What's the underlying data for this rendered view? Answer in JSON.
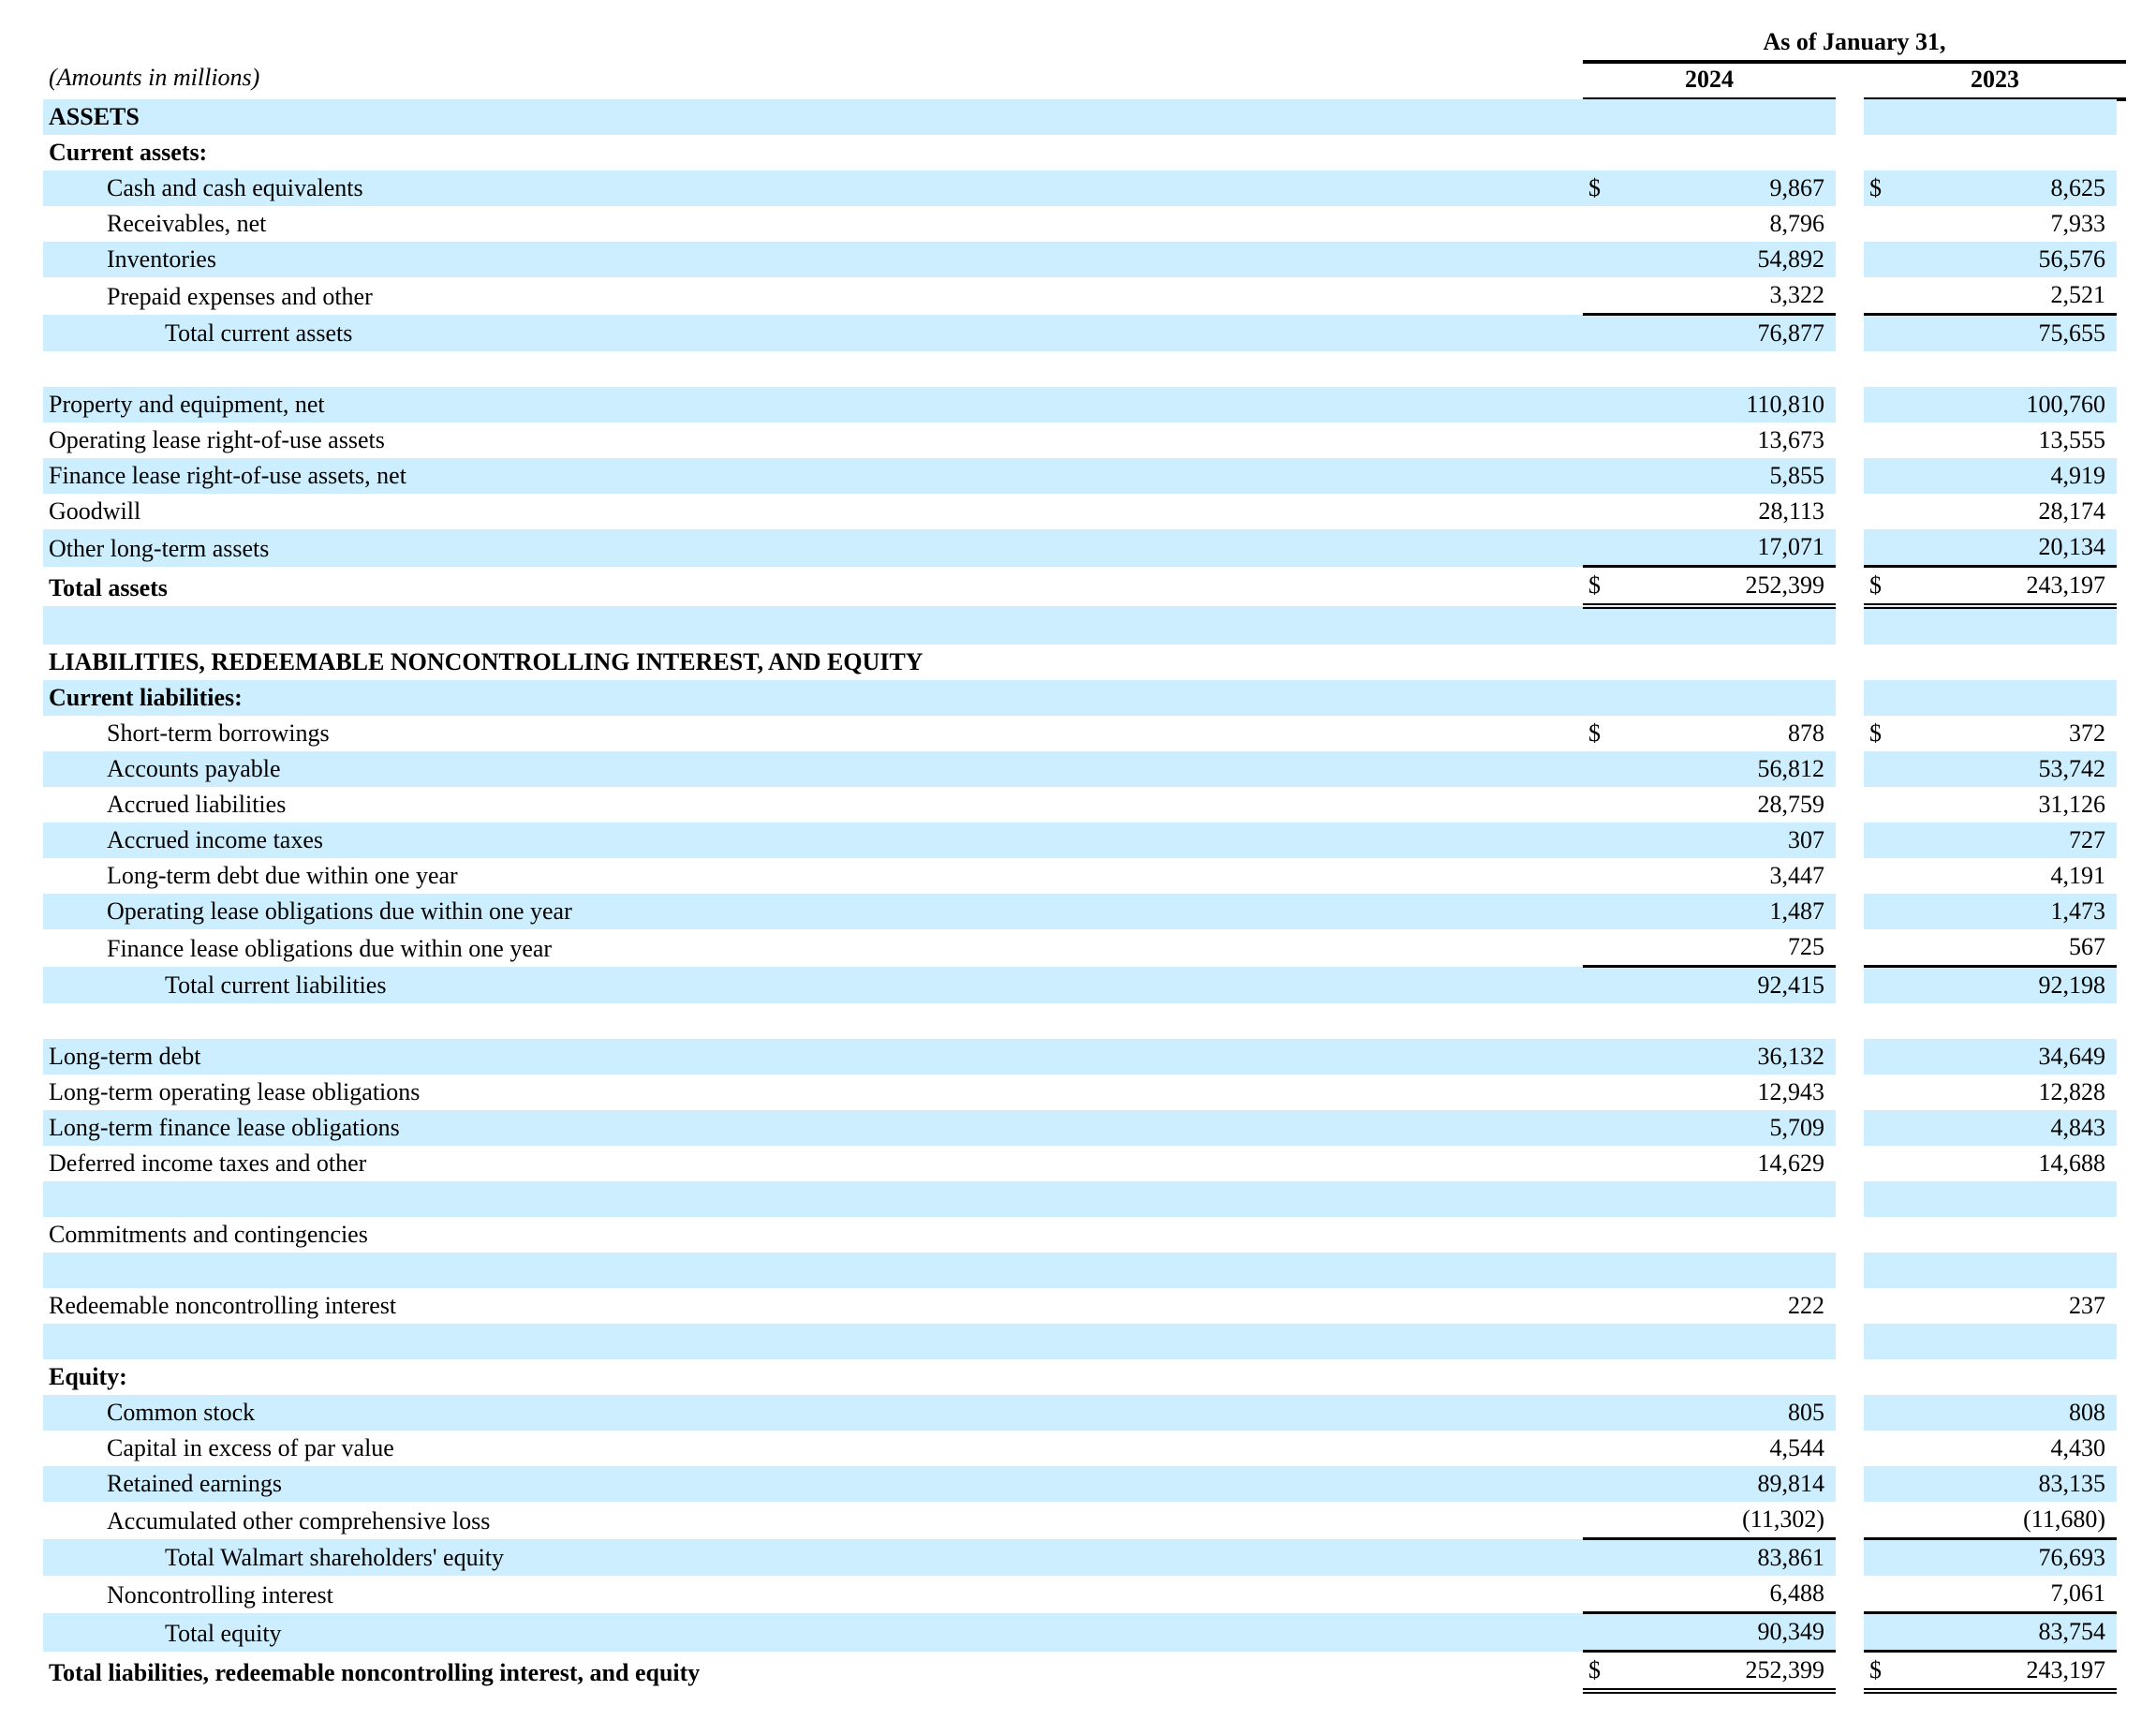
{
  "header": {
    "as_of": "As of January 31,",
    "units": "(Amounts in millions)",
    "col_2024": "2024",
    "col_2023": "2023"
  },
  "rows": [
    {
      "label": "ASSETS",
      "indent": 0,
      "bold": true,
      "shade": true
    },
    {
      "label": "Current assets:",
      "indent": 0,
      "bold": true,
      "shade": false
    },
    {
      "label": "Cash and cash equivalents",
      "indent": 1,
      "shade": true,
      "cur": true,
      "v2024": "9,867",
      "v2023": "8,625"
    },
    {
      "label": "Receivables, net",
      "indent": 1,
      "shade": false,
      "v2024": "8,796",
      "v2023": "7,933"
    },
    {
      "label": "Inventories",
      "indent": 1,
      "shade": true,
      "v2024": "54,892",
      "v2023": "56,576"
    },
    {
      "label": "Prepaid expenses and other",
      "indent": 1,
      "shade": false,
      "v2024": "3,322",
      "v2023": "2,521"
    },
    {
      "label": "Total current assets",
      "indent": 2,
      "shade": true,
      "top_rule": true,
      "v2024": "76,877",
      "v2023": "75,655"
    },
    {
      "label": "",
      "shade": false,
      "spacer": true
    },
    {
      "label": "Property and equipment, net",
      "indent": 0,
      "shade": true,
      "v2024": "110,810",
      "v2023": "100,760"
    },
    {
      "label": "Operating lease right-of-use assets",
      "indent": 0,
      "shade": false,
      "v2024": "13,673",
      "v2023": "13,555"
    },
    {
      "label": "Finance lease right-of-use assets, net",
      "indent": 0,
      "shade": true,
      "v2024": "5,855",
      "v2023": "4,919"
    },
    {
      "label": "Goodwill",
      "indent": 0,
      "shade": false,
      "v2024": "28,113",
      "v2023": "28,174"
    },
    {
      "label": "Other long-term assets",
      "indent": 0,
      "shade": true,
      "v2024": "17,071",
      "v2023": "20,134"
    },
    {
      "label": "Total assets",
      "indent": 0,
      "bold": true,
      "shade": false,
      "cur": true,
      "top_rule": true,
      "double": true,
      "v2024": "252,399",
      "v2023": "243,197"
    },
    {
      "label": "",
      "shade": true,
      "spacer": true
    },
    {
      "label": "LIABILITIES, REDEEMABLE NONCONTROLLING INTEREST, AND EQUITY",
      "indent": 0,
      "bold": true,
      "shade": false
    },
    {
      "label": "Current liabilities:",
      "indent": 0,
      "bold": true,
      "shade": true
    },
    {
      "label": "Short-term borrowings",
      "indent": 1,
      "shade": false,
      "cur": true,
      "v2024": "878",
      "v2023": "372"
    },
    {
      "label": "Accounts payable",
      "indent": 1,
      "shade": true,
      "v2024": "56,812",
      "v2023": "53,742"
    },
    {
      "label": "Accrued liabilities",
      "indent": 1,
      "shade": false,
      "v2024": "28,759",
      "v2023": "31,126"
    },
    {
      "label": "Accrued income taxes",
      "indent": 1,
      "shade": true,
      "v2024": "307",
      "v2023": "727"
    },
    {
      "label": "Long-term debt due within one year",
      "indent": 1,
      "shade": false,
      "v2024": "3,447",
      "v2023": "4,191"
    },
    {
      "label": "Operating lease obligations due within one year",
      "indent": 1,
      "shade": true,
      "v2024": "1,487",
      "v2023": "1,473"
    },
    {
      "label": "Finance lease obligations due within one year",
      "indent": 1,
      "shade": false,
      "v2024": "725",
      "v2023": "567"
    },
    {
      "label": "Total current liabilities",
      "indent": 2,
      "shade": true,
      "top_rule": true,
      "v2024": "92,415",
      "v2023": "92,198"
    },
    {
      "label": "",
      "shade": false,
      "spacer": true
    },
    {
      "label": "Long-term debt",
      "indent": 0,
      "shade": true,
      "v2024": "36,132",
      "v2023": "34,649"
    },
    {
      "label": "Long-term operating lease obligations",
      "indent": 0,
      "shade": false,
      "v2024": "12,943",
      "v2023": "12,828"
    },
    {
      "label": "Long-term finance lease obligations",
      "indent": 0,
      "shade": true,
      "v2024": "5,709",
      "v2023": "4,843"
    },
    {
      "label": "Deferred income taxes and other",
      "indent": 0,
      "shade": false,
      "v2024": "14,629",
      "v2023": "14,688"
    },
    {
      "label": "",
      "shade": true,
      "spacer": true
    },
    {
      "label": "Commitments and contingencies",
      "indent": 0,
      "shade": false
    },
    {
      "label": "",
      "shade": true,
      "spacer": true
    },
    {
      "label": "Redeemable noncontrolling interest",
      "indent": 0,
      "shade": false,
      "v2024": "222",
      "v2023": "237"
    },
    {
      "label": "",
      "shade": true,
      "spacer": true
    },
    {
      "label": "Equity:",
      "indent": 0,
      "bold": true,
      "shade": false
    },
    {
      "label": "Common stock",
      "indent": 1,
      "shade": true,
      "v2024": "805",
      "v2023": "808"
    },
    {
      "label": "Capital in excess of par value",
      "indent": 1,
      "shade": false,
      "v2024": "4,544",
      "v2023": "4,430"
    },
    {
      "label": "Retained earnings",
      "indent": 1,
      "shade": true,
      "v2024": "89,814",
      "v2023": "83,135"
    },
    {
      "label": "Accumulated other comprehensive loss",
      "indent": 1,
      "shade": false,
      "v2024": "(11,302)",
      "v2023": "(11,680)"
    },
    {
      "label": "Total Walmart shareholders' equity",
      "indent": 2,
      "shade": true,
      "top_rule": true,
      "v2024": "83,861",
      "v2023": "76,693"
    },
    {
      "label": "Noncontrolling interest",
      "indent": 1,
      "shade": false,
      "v2024": "6,488",
      "v2023": "7,061"
    },
    {
      "label": "Total equity",
      "indent": 2,
      "shade": true,
      "top_rule": true,
      "v2024": "90,349",
      "v2023": "83,754"
    },
    {
      "label": "Total liabilities, redeemable noncontrolling interest, and equity",
      "indent": 0,
      "bold": true,
      "shade": false,
      "cur": true,
      "top_rule": true,
      "double": true,
      "v2024": "252,399",
      "v2023": "243,197"
    }
  ],
  "currency_symbol": "$"
}
